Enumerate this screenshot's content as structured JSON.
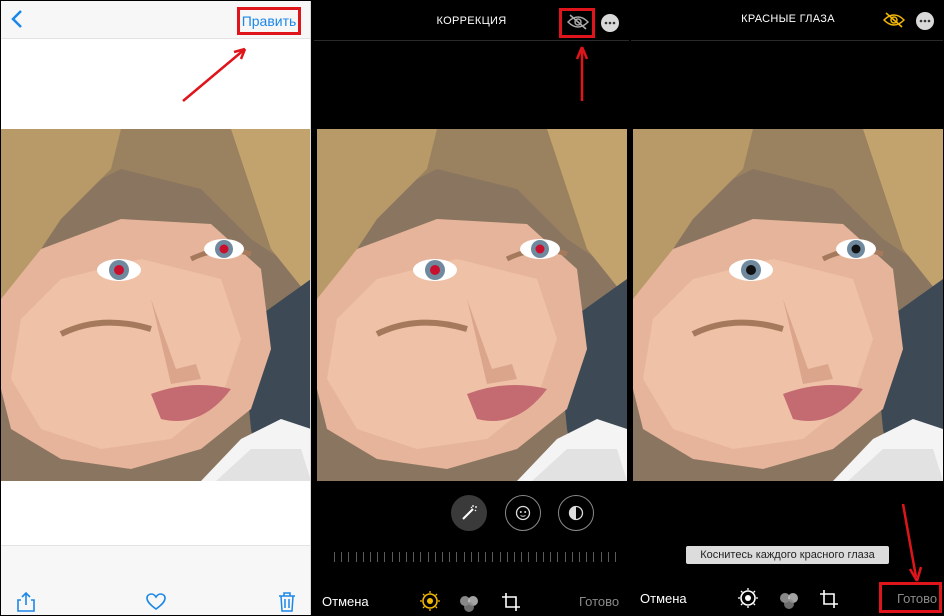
{
  "panel1": {
    "edit_label": "Править"
  },
  "panel2": {
    "title": "КОРРЕКЦИЯ",
    "cancel_label": "Отмена",
    "done_label": "Готово"
  },
  "panel3": {
    "title": "КРАСНЫЕ ГЛАЗА",
    "hint": "Коснитесь каждого красного глаза",
    "cancel_label": "Отмена",
    "done_label": "Готово"
  },
  "colors": {
    "ios_blue": "#1b87e8",
    "highlight_red": "#e0141b",
    "eye_red": "#c8102e",
    "active_yellow": "#f2b705"
  },
  "icons": [
    "back-chevron-icon",
    "share-icon",
    "heart-icon",
    "trash-icon",
    "hide-eye-icon",
    "more-icon",
    "magic-wand-icon",
    "red-eye-icon",
    "filters-icon",
    "adjust-dial-icon",
    "color-circles-icon",
    "crop-icon"
  ]
}
